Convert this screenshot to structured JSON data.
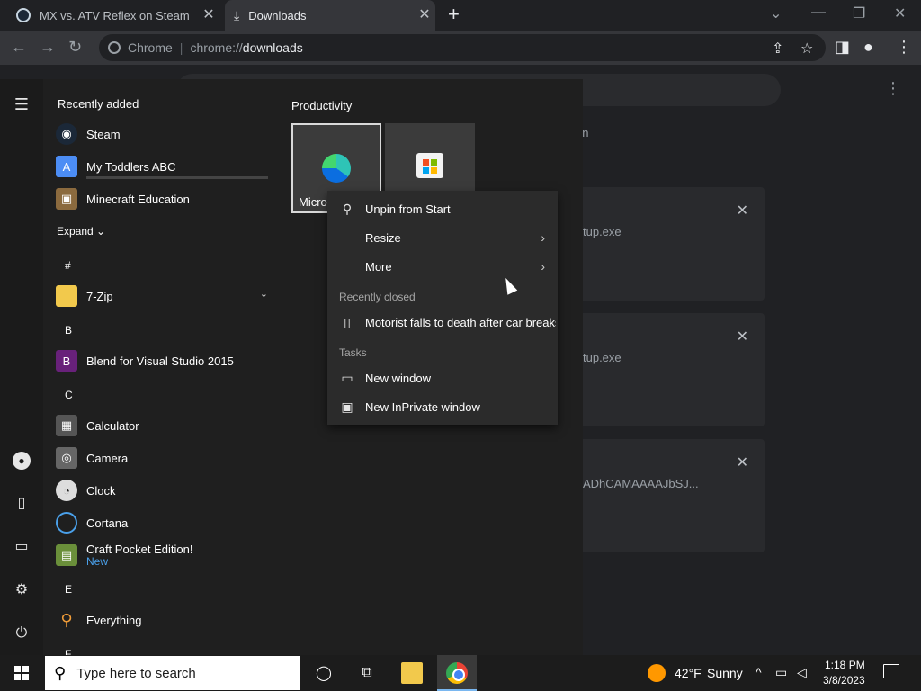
{
  "browser": {
    "tabs": [
      {
        "title": "MX vs. ATV Reflex on Steam",
        "active": false
      },
      {
        "title": "Downloads",
        "active": true
      }
    ],
    "new_tab_label": "+",
    "omnibox": {
      "site_label": "Chrome",
      "url_scheme": "chrome://",
      "url_host": "downloads"
    }
  },
  "downloads_page": {
    "date_fragment": "on",
    "items": [
      {
        "name_fragment": "tup.exe"
      },
      {
        "name_fragment": "tup.exe"
      },
      {
        "name_fragment": "ADhCAMAAAAJbSJ..."
      }
    ]
  },
  "start_menu": {
    "recently_added_heading": "Recently added",
    "recent_apps": [
      {
        "label": "Steam",
        "icon": "steam-icon"
      },
      {
        "label": "My Toddlers ABC",
        "icon": "abc-icon"
      },
      {
        "label": "Minecraft Education",
        "icon": "minecraft-icon"
      }
    ],
    "expand_label": "Expand",
    "groups": [
      {
        "letter": "#",
        "apps": [
          {
            "label": "7-Zip",
            "icon": "folder-icon",
            "expandable": true
          }
        ]
      },
      {
        "letter": "B",
        "apps": [
          {
            "label": "Blend for Visual Studio 2015",
            "icon": "blend-icon"
          }
        ]
      },
      {
        "letter": "C",
        "apps": [
          {
            "label": "Calculator",
            "icon": "calculator-icon"
          },
          {
            "label": "Camera",
            "icon": "camera-icon"
          },
          {
            "label": "Clock",
            "icon": "clock-icon"
          },
          {
            "label": "Cortana",
            "icon": "cortana-icon"
          },
          {
            "label": "Craft Pocket Edition!",
            "sub": "New",
            "icon": "craft-icon"
          }
        ]
      },
      {
        "letter": "E",
        "apps": [
          {
            "label": "Everything",
            "icon": "everything-icon"
          }
        ]
      }
    ],
    "next_letter": "F",
    "tiles_heading": "Productivity",
    "tiles": [
      {
        "label": "Micro",
        "icon": "edge-icon"
      },
      {
        "label": "",
        "icon": "store-icon"
      }
    ]
  },
  "context_menu": {
    "items": [
      {
        "label": "Unpin from Start",
        "icon": "unpin-icon"
      },
      {
        "label": "Resize",
        "submenu": true
      },
      {
        "label": "More",
        "submenu": true
      }
    ],
    "recently_closed_heading": "Recently closed",
    "recently_closed": [
      {
        "label": "Motorist falls to death after car breaks...",
        "icon": "page-icon"
      }
    ],
    "tasks_heading": "Tasks",
    "tasks": [
      {
        "label": "New window",
        "icon": "window-icon"
      },
      {
        "label": "New InPrivate window",
        "icon": "inprivate-icon"
      }
    ]
  },
  "taskbar": {
    "search_placeholder": "Type here to search",
    "weather": {
      "temp": "42°F",
      "condition": "Sunny"
    },
    "clock": {
      "time": "1:18 PM",
      "date": "3/8/2023"
    }
  },
  "colors": {
    "accent": "#4aa0ea",
    "taskbar": "#1c1c1c",
    "menu": "#2b2b2b"
  }
}
